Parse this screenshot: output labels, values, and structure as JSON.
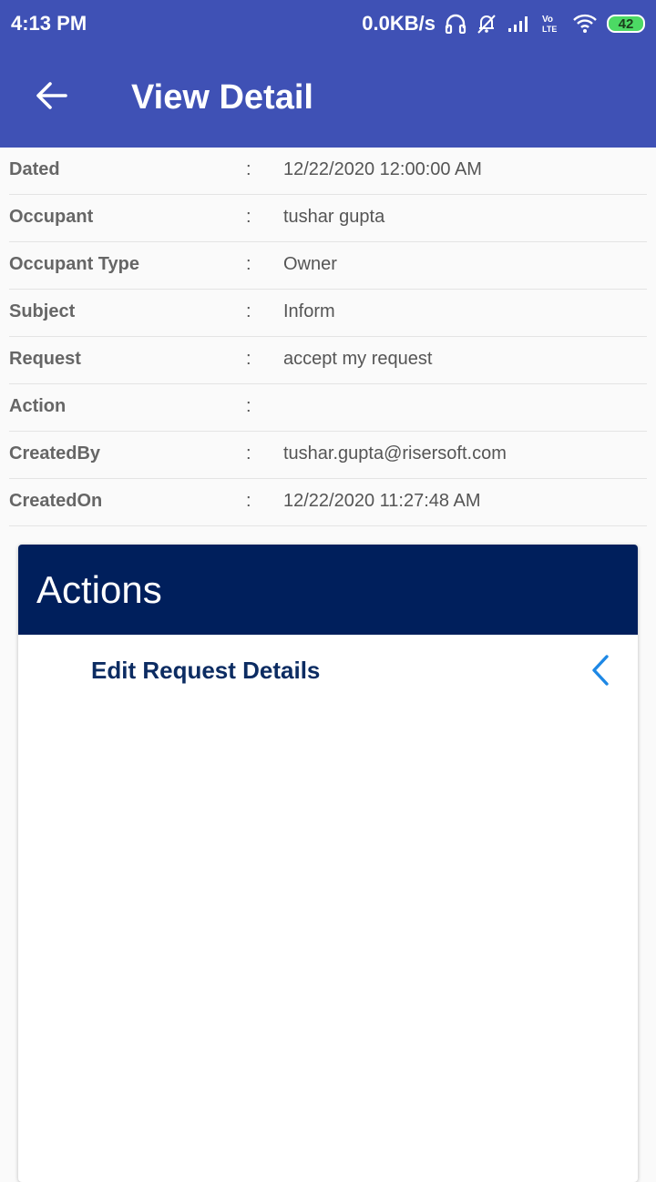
{
  "status_bar": {
    "time": "4:13 PM",
    "network_speed": "0.0KB/s",
    "battery_level": "42",
    "icons": [
      "headphones-icon",
      "alarm-off-icon",
      "signal-icon",
      "volte-icon",
      "wifi-icon",
      "battery-icon"
    ],
    "volte_text": "Vo\nLTE"
  },
  "toolbar": {
    "title": "View Detail",
    "back_icon": "back-arrow-icon",
    "background": "#3f51b5"
  },
  "details": [
    {
      "label": "Dated",
      "separator": ":",
      "value": "12/22/2020 12:00:00 AM"
    },
    {
      "label": "Occupant",
      "separator": ":",
      "value": "tushar gupta"
    },
    {
      "label": "Occupant Type",
      "separator": ":",
      "value": "Owner"
    },
    {
      "label": "Subject",
      "separator": ":",
      "value": "Inform"
    },
    {
      "label": "Request",
      "separator": ":",
      "value": "accept my request"
    },
    {
      "label": "Action",
      "separator": ":",
      "value": ""
    },
    {
      "label": "CreatedBy",
      "separator": ":",
      "value": "tushar.gupta@risersoft.com"
    },
    {
      "label": "CreatedOn",
      "separator": ":",
      "value": "12/22/2020 11:27:48 AM"
    }
  ],
  "actions_card": {
    "title": "Actions",
    "header_background": "#001f5c",
    "items": [
      {
        "label": "Edit Request Details",
        "icon": "chevron-left-icon"
      }
    ]
  },
  "colors": {
    "accent": "#1e88e5",
    "label_text": "#666666",
    "value_text": "#555555",
    "action_text": "#0c2c62"
  }
}
